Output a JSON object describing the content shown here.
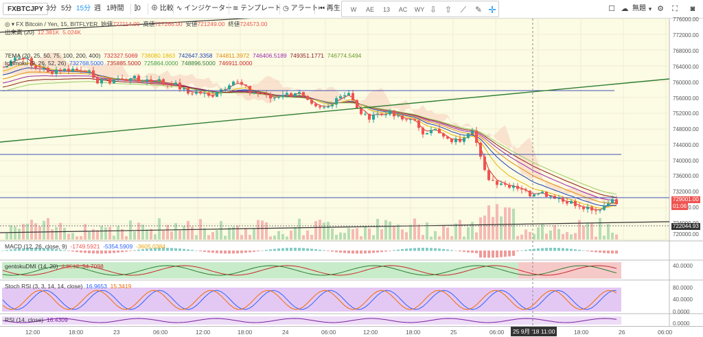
{
  "toolbar": {
    "symbol": "FXBTCJPY",
    "intervals": [
      "3分",
      "5分",
      "15分",
      "週",
      "1時間"
    ],
    "active_interval": "15分",
    "compare": "比較",
    "indicators": "インジケーター",
    "templates": "テンプレート",
    "alert": "アラート",
    "replay": "再生",
    "layout_name": "無題",
    "drawing_tools": [
      "W",
      "W",
      "AE",
      "AE",
      "13",
      "13",
      "AC",
      "AC",
      "WY",
      "WY"
    ]
  },
  "legend": {
    "title": "FX Bitcoin / Yen, 15, BITFLYER",
    "open_label": "始値",
    "open": "727114.00",
    "high_label": "高値",
    "high": "727266.00",
    "low_label": "安値",
    "low": "721249.00",
    "close_label": "終値",
    "close": "724573.00",
    "volume_label": "出来高 (20)",
    "volume_value": "12.381K",
    "volume_ma": "5.024K",
    "ema_label": "7EMA (20, 25, 50, 75, 100, 200, 400)",
    "ema_values": [
      "732327.5069",
      "738080.1863",
      "742647.3358",
      "744811.3972",
      "746406.5189",
      "749351.1771",
      "746774.5494"
    ],
    "ichimoku_label": "Ichimoku (9, 26, 52, 26)",
    "ichimoku_values": [
      "732768.5000",
      "735885.5000",
      "725864.0000",
      "748896.5000",
      "746911.0000"
    ],
    "macd_label": "MACD (12, 26, close, 9)",
    "macd_values": [
      "-1749.5921",
      "-5354.5909",
      "-3605.0384"
    ],
    "dmi_label": "gentokuDMI (14, 20)",
    "dmi_values": [
      "4.8513",
      "54.7098"
    ],
    "stoch_label": "Stoch RSI (3, 3, 14, 14, close)",
    "stoch_values": [
      "16.9653",
      "15.3419"
    ],
    "rsi_label": "RSI (14, close)",
    "rsi_value": "16.4309"
  },
  "price_axis": {
    "labels": [
      "776000.00",
      "772000.00",
      "768000.00",
      "764000.00",
      "760000.00",
      "756000.00",
      "752000.00",
      "748000.00",
      "744000.00",
      "740000.00",
      "736000.00",
      "732000.00",
      "728000.00",
      "724000.00",
      "720000.00"
    ],
    "current_price": "729001.00",
    "countdown": "01:06",
    "line_price": "722044.93",
    "dmi_level": "40.0000",
    "stoch_levels": [
      "80.0000",
      "40.0000",
      "0.0000"
    ],
    "rsi_level": "0.0000"
  },
  "time_axis": {
    "labels": [
      "12:00",
      "18:00",
      "23",
      "06:00",
      "12:00",
      "18:00",
      "24",
      "06:00",
      "12:00",
      "18:00",
      "25",
      "06:00",
      "18:00",
      "26",
      "06:00"
    ],
    "crosshair_label": "25 9月 '18  11:00"
  },
  "colors": {
    "up": "#26a69a",
    "down": "#ef5350",
    "chart_bg": "#fcfbe4",
    "accent": "#2196f3"
  }
}
